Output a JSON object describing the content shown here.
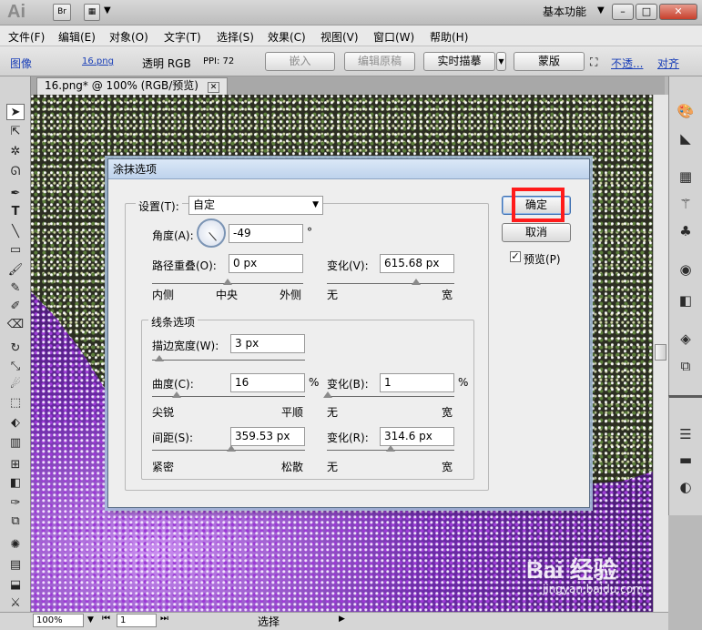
{
  "titlebar": {
    "app_logo": "Ai",
    "bridge_button": "Br",
    "workspace": "基本功能",
    "minimize": "–",
    "maximize": "□",
    "close": "✕",
    "dropdown": "▼"
  },
  "menubar": {
    "items": [
      "文件(F)",
      "编辑(E)",
      "对象(O)",
      "文字(T)",
      "选择(S)",
      "效果(C)",
      "视图(V)",
      "窗口(W)",
      "帮助(H)"
    ]
  },
  "controlbar": {
    "image_label": "图像",
    "file_link": "16.png",
    "transparency": "透明 RGB",
    "ppi": "PPI: 72",
    "embed": "嵌入",
    "edit_original": "编辑原稿",
    "live_trace": "实时描摹",
    "mask": "蒙版",
    "opacity_link": "不透...",
    "align_link": "对齐"
  },
  "document": {
    "tab_title": "16.png* @ 100% (RGB/预览)",
    "tab_close": "✕"
  },
  "statusbar": {
    "zoom": "100%",
    "page": "1",
    "tool": "选择"
  },
  "dialog": {
    "title": "涂抹选项",
    "settings_label": "设置(T):",
    "settings_value": "自定",
    "angle_label": "角度(A):",
    "angle_value": "-49",
    "angle_unit": "°",
    "path_overlap_label": "路径重叠(O):",
    "path_overlap_value": "0 px",
    "path_overlap_min": "内侧",
    "path_overlap_mid": "中央",
    "path_overlap_max": "外侧",
    "path_overlap_slider": 0.5,
    "variation1_label": "变化(V):",
    "variation1_value": "615.68 px",
    "variation1_min": "无",
    "variation1_max": "宽",
    "variation1_slider": 0.7,
    "line_options_label": "线条选项",
    "stroke_width_label": "描边宽度(W):",
    "stroke_width_value": "3 px",
    "stroke_width_slider": 0.05,
    "curviness_label": "曲度(C):",
    "curviness_value": "16",
    "curviness_unit": "%",
    "curviness_min": "尖锐",
    "curviness_max": "平顺",
    "curviness_slider": 0.16,
    "variation2_label": "变化(B):",
    "variation2_value": "1",
    "variation2_unit": "%",
    "variation2_min": "无",
    "variation2_max": "宽",
    "variation2_slider": 0.01,
    "spacing_label": "间距(S):",
    "spacing_value": "359.53 px",
    "spacing_min": "紧密",
    "spacing_max": "松散",
    "spacing_slider": 0.52,
    "variation3_label": "变化(R):",
    "variation3_value": "314.6 px",
    "variation3_min": "无",
    "variation3_max": "宽",
    "variation3_slider": 0.5,
    "ok": "确定",
    "cancel": "取消",
    "preview_label": "预览(P)",
    "preview_checked": "✓"
  },
  "watermark": {
    "brand": "Bai 经验",
    "url": "jingyan.baidu.com"
  },
  "colors": {
    "highlight": "#ff1b1b",
    "link": "#1a3fb8"
  }
}
